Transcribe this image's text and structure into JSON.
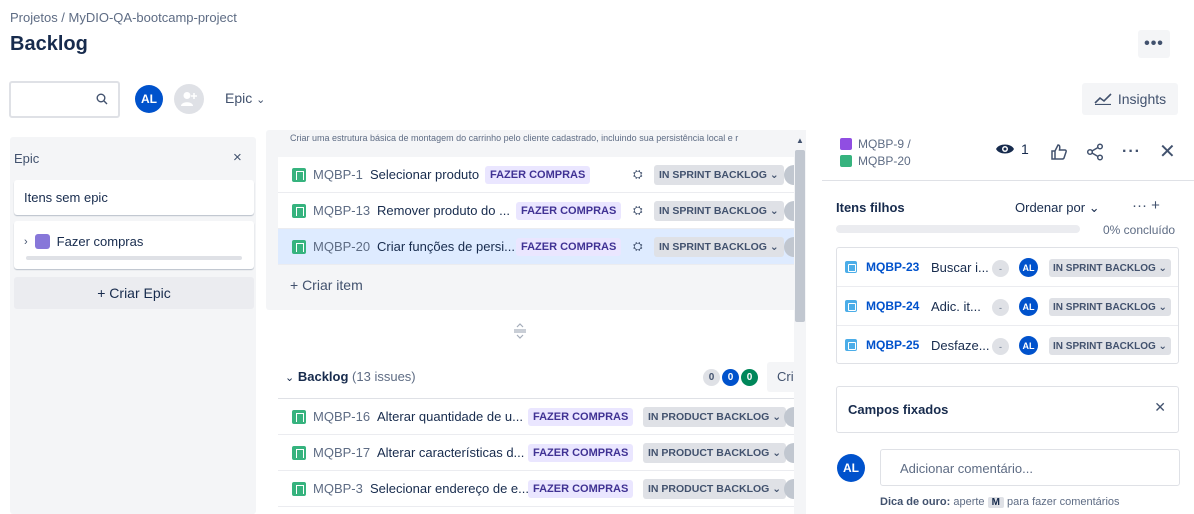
{
  "header": {
    "breadcrumb": "Projetos  /  MyDIO-QA-bootcamp-project",
    "title": "Backlog",
    "more_label": "•••"
  },
  "toolbar": {
    "avatar_initials": "AL",
    "epic_filter": "Epic",
    "insights": "Insights"
  },
  "epic_panel": {
    "title": "Epic",
    "close": "×",
    "no_epic": "Itens sem epic",
    "epics": [
      {
        "name": "Fazer compras",
        "color": "#8777d9"
      }
    ],
    "create_epic": "+ Criar Epic"
  },
  "sprint": {
    "description": "Criar uma estrutura básica de montagem do carrinho pelo cliente cadastrado, incluindo sua persistência local e r",
    "issues": [
      {
        "key": "MQBP-1",
        "summary": "Selecionar produto",
        "epic": "FAZER COMPRAS",
        "status": "IN SPRINT BACKLOG ⌄"
      },
      {
        "key": "MQBP-13",
        "summary": "Remover produto do ...",
        "epic": "FAZER COMPRAS",
        "status": "IN SPRINT BACKLOG ⌄"
      },
      {
        "key": "MQBP-20",
        "summary": "Criar funções de persi...",
        "epic": "FAZER COMPRAS",
        "status": "IN SPRINT BACKLOG ⌄"
      }
    ],
    "create_item": "+ Criar item"
  },
  "backlog": {
    "title": "Backlog",
    "count": "(13 issues)",
    "points": [
      "0",
      "0",
      "0"
    ],
    "create": "Cri",
    "issues": [
      {
        "key": "MQBP-16",
        "summary": "Alterar quantidade de u...",
        "epic": "FAZER COMPRAS",
        "status": "IN PRODUCT BACKLOG ⌄"
      },
      {
        "key": "MQBP-17",
        "summary": "Alterar características d...",
        "epic": "FAZER COMPRAS",
        "status": "IN PRODUCT BACKLOG ⌄"
      },
      {
        "key": "MQBP-3",
        "summary": "Selecionar endereço de e...",
        "epic": "FAZER COMPRAS",
        "status": "IN PRODUCT BACKLOG ⌄"
      }
    ]
  },
  "detail": {
    "parent_key": "MQBP-9  /",
    "issue_key": "MQBP-20",
    "watchers": "1",
    "child_title": "Itens filhos",
    "order_by": "Ordenar por  ⌄",
    "tools": "···   +",
    "progress": 0,
    "progress_label": "0% concluído",
    "children": [
      {
        "key": "MQBP-23",
        "summary": "Buscar i...",
        "priority": "-",
        "assignee": "AL",
        "status": "IN SPRINT BACKLOG ⌄"
      },
      {
        "key": "MQBP-24",
        "summary": "Adic. it...",
        "priority": "-",
        "assignee": "AL",
        "status": "IN SPRINT BACKLOG ⌄"
      },
      {
        "key": "MQBP-25",
        "summary": "Desfaze...",
        "priority": "-",
        "assignee": "AL",
        "status": "IN SPRINT BACKLOG ⌄"
      }
    ],
    "pinned_title": "Campos fixados",
    "comment_placeholder": "Adicionar comentário...",
    "tip_bold": "Dica de ouro:",
    "tip_pre": "aperte",
    "tip_key": "M",
    "tip_post": "para fazer comentários"
  },
  "colors": {
    "accent": "#0052cc",
    "story": "#36b37e",
    "subtask": "#4bade8",
    "epic_lozenge": "#eae6ff"
  }
}
